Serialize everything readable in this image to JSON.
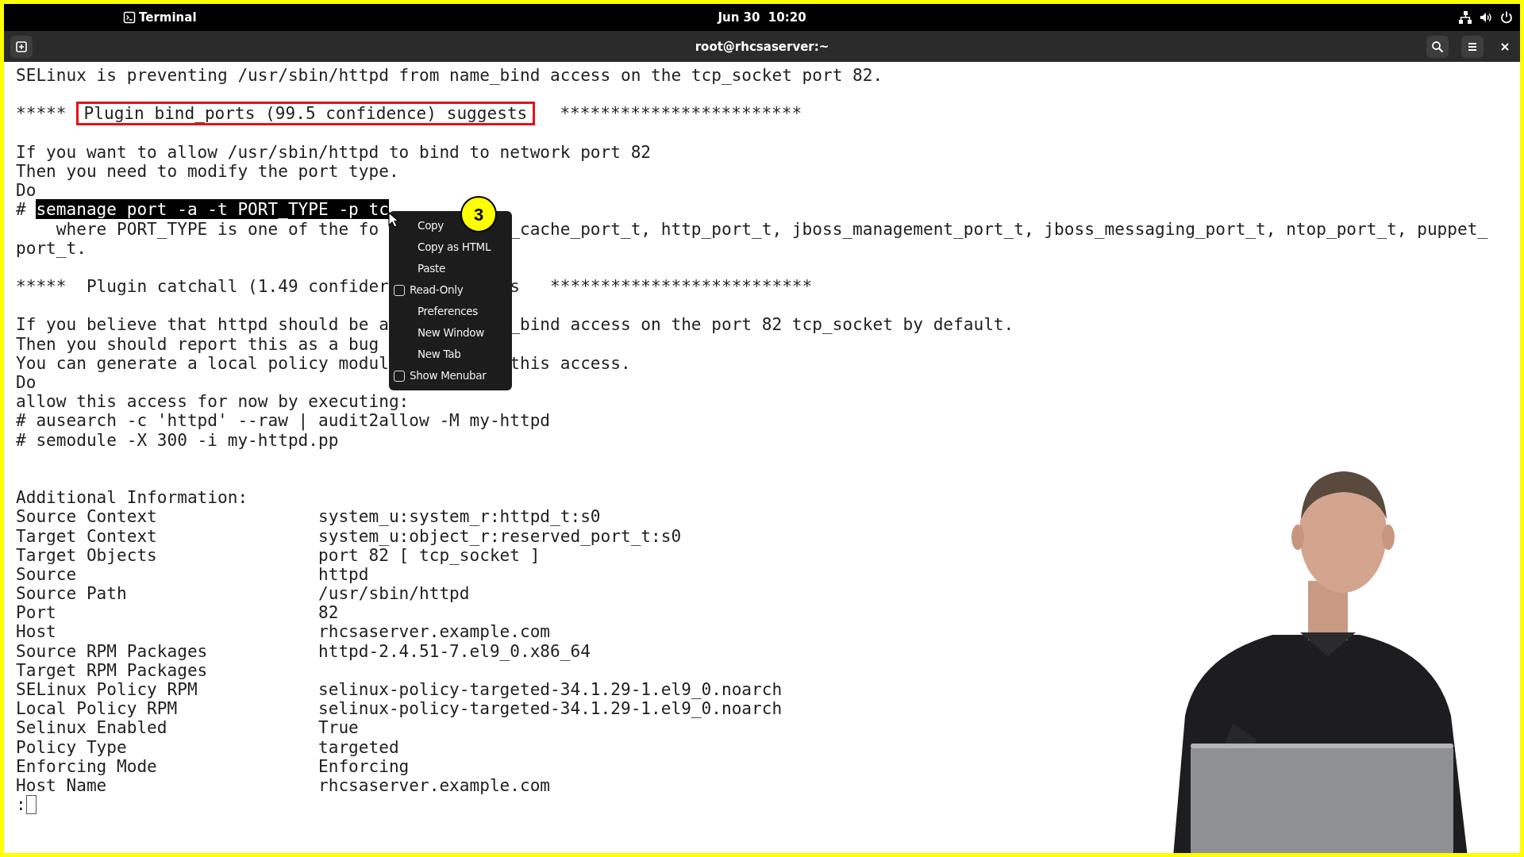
{
  "top_bar": {
    "app_name": "Terminal",
    "clock": "Jun 30  10:20"
  },
  "window": {
    "title": "root@rhcsaserver:~"
  },
  "terminal": {
    "blocks": [
      [
        {
          "kind": "text",
          "text": "SELinux is preventing /usr/sbin/httpd from name_bind access on the tcp_socket port 82."
        }
      ],
      [
        {
          "kind": "banner",
          "prefix": "*****",
          "boxed": "Plugin bind_ports (99.5 confidence) suggests",
          "suffix": "************************"
        }
      ],
      [
        {
          "kind": "text",
          "text": "If you want to allow /usr/sbin/httpd to bind to network port 82"
        },
        {
          "kind": "text",
          "text": "Then you need to modify the port type."
        },
        {
          "kind": "text",
          "text": "Do"
        },
        {
          "kind": "command",
          "prefix": "#",
          "highlighted": "semanage port -a -t PORT_TYPE -p tc"
        },
        {
          "kind": "split",
          "left": "    where PORT_TYPE is one of the fo",
          "right": "_cache_port_t, http_port_t, jboss_management_port_t, jboss_messaging_port_t, ntop_port_t, puppet_"
        },
        {
          "kind": "text",
          "text": "port_t."
        }
      ],
      [
        {
          "kind": "split",
          "left": "*****  Plugin catchall (1.49 confider",
          "right": "s   **************************"
        }
      ],
      [
        {
          "kind": "split",
          "left": "If you believe that httpd should be a",
          "right": "_bind access on the port 82 tcp_socket by default."
        },
        {
          "kind": "text",
          "text": "Then you should report this as a bug"
        },
        {
          "kind": "split",
          "left": "You can generate a local policy modul",
          "right": "this access."
        },
        {
          "kind": "text",
          "text": "Do"
        },
        {
          "kind": "text",
          "text": "allow this access for now by executing:"
        },
        {
          "kind": "text",
          "text": "# ausearch -c 'httpd' --raw | audit2allow -M my-httpd"
        },
        {
          "kind": "text",
          "text": "# semodule -X 300 -i my-httpd.pp"
        }
      ]
    ],
    "info": {
      "heading": "Additional Information:",
      "fields": [
        {
          "label": "Source Context",
          "value": "system_u:system_r:httpd_t:s0"
        },
        {
          "label": "Target Context",
          "value": "system_u:object_r:reserved_port_t:s0"
        },
        {
          "label": "Target Objects",
          "value": "port 82 [ tcp_socket ]"
        },
        {
          "label": "Source",
          "value": "httpd"
        },
        {
          "label": "Source Path",
          "value": "/usr/sbin/httpd"
        },
        {
          "label": "Port",
          "value": "82"
        },
        {
          "label": "Host",
          "value": "rhcsaserver.example.com"
        },
        {
          "label": "Source RPM Packages",
          "value": "httpd-2.4.51-7.el9_0.x86_64"
        },
        {
          "label": "Target RPM Packages"
        },
        {
          "label": "SELinux Policy RPM",
          "value": "selinux-policy-targeted-34.1.29-1.el9_0.noarch"
        },
        {
          "label": "Local Policy RPM",
          "value": "selinux-policy-targeted-34.1.29-1.el9_0.noarch"
        },
        {
          "label": "Selinux Enabled",
          "value": "True"
        },
        {
          "label": "Policy Type",
          "value": "targeted"
        },
        {
          "label": "Enforcing Mode",
          "value": "Enforcing"
        },
        {
          "label": "Host Name",
          "value": "rhcsaserver.example.com"
        }
      ]
    },
    "prompt": ":"
  },
  "context_menu": {
    "items": [
      {
        "label": "Copy",
        "kind": "action"
      },
      {
        "label": "Copy as HTML",
        "kind": "action"
      },
      {
        "label": "Paste",
        "kind": "action"
      },
      {
        "label": "Read-Only",
        "kind": "check",
        "checked": false
      },
      {
        "label": "Preferences",
        "kind": "action"
      },
      {
        "label": "New Window",
        "kind": "action"
      },
      {
        "label": "New Tab",
        "kind": "action"
      },
      {
        "label": "Show Menubar",
        "kind": "check",
        "checked": false
      }
    ]
  },
  "step_badge": "3"
}
